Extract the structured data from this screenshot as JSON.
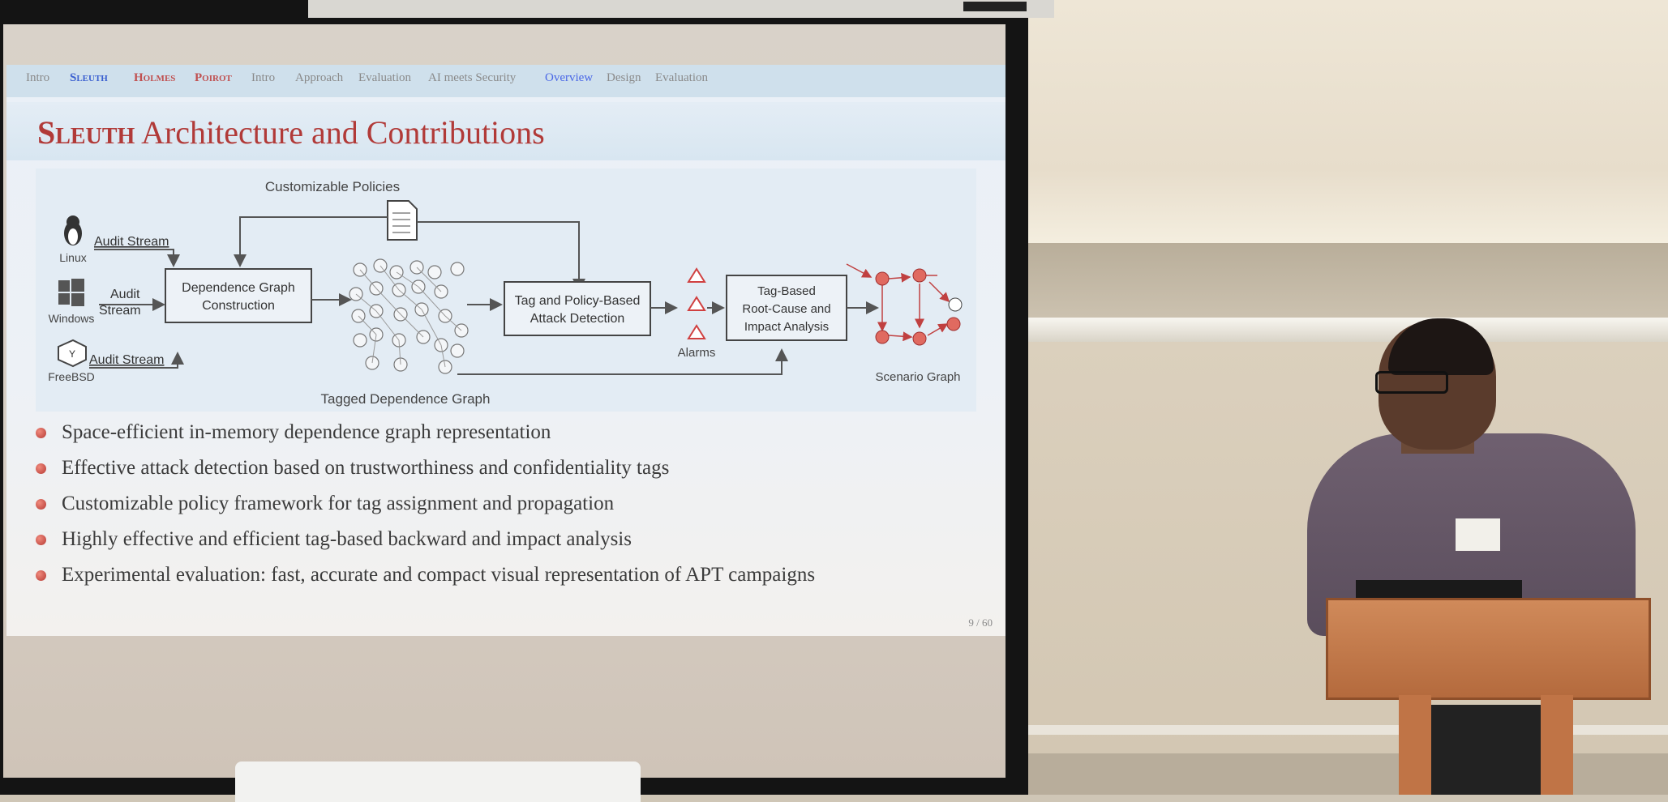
{
  "slide": {
    "nav": {
      "items": [
        "Intro",
        "Sleuth",
        "Holmes",
        "Poirot",
        "Intro",
        "Approach",
        "Evaluation",
        "AI meets Security",
        "Overview",
        "Design",
        "Evaluation"
      ]
    },
    "title_sc": "Sleuth",
    "title_rest": "Architecture and Contributions",
    "figure": {
      "customizable_policies": "Customizable  Policies",
      "linux": "Linux",
      "windows": "Windows",
      "freebsd": "FreeBSD",
      "audit_stream": "Audit Stream",
      "audit": "Audit",
      "stream": "Stream",
      "dep_graph_1": "Dependence Graph",
      "dep_graph_2": "Construction",
      "tagged_graph": "Tagged Dependence Graph",
      "tag_policy_1": "Tag and Policy-Based",
      "tag_policy_2": "Attack Detection",
      "alarms": "Alarms",
      "root_cause_1": "Tag-Based",
      "root_cause_2": "Root-Cause and",
      "root_cause_3": "Impact Analysis",
      "scenario_graph": "Scenario Graph"
    },
    "bullets": [
      "Space-efficient in-memory dependence graph representation",
      "Effective attack detection based on trustworthiness and confidentiality tags",
      "Customizable policy framework for tag assignment and propagation",
      "Highly effective and efficient tag-based backward and impact analysis",
      "Experimental evaluation: fast, accurate and compact visual representation of APT campaigns"
    ],
    "page_number": "9 / 60"
  },
  "colors": {
    "accent_red": "#b13a38",
    "navbar_blue": "#cfe0ec",
    "lectern_wood": "#c07446"
  },
  "icons": [
    "linux-penguin-icon",
    "windows-logo-icon",
    "freebsd-logo-icon",
    "document-icon",
    "alarm-triangle-icon"
  ]
}
